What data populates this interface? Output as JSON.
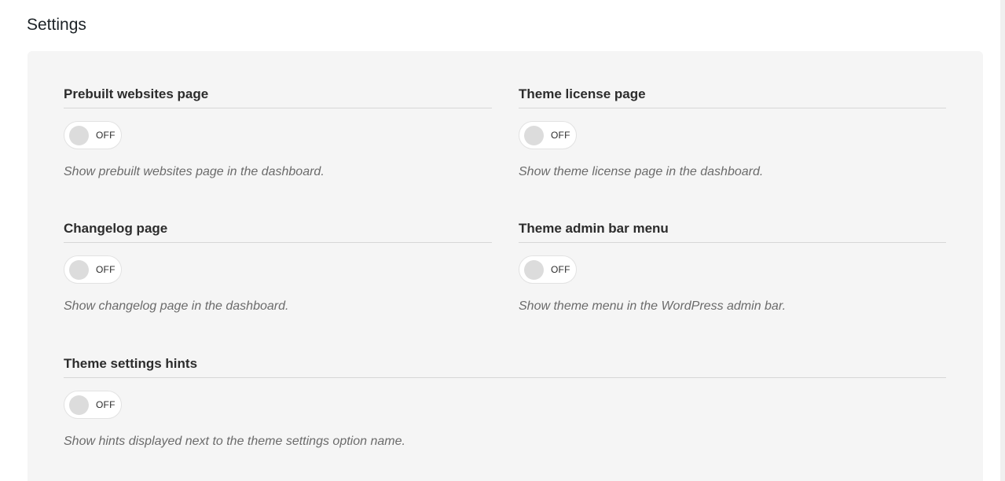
{
  "page": {
    "title": "Settings"
  },
  "settings": [
    {
      "title": "Prebuilt websites page",
      "toggle_label": "OFF",
      "description": "Show prebuilt websites page in the dashboard.",
      "enabled": false
    },
    {
      "title": "Theme license page",
      "toggle_label": "OFF",
      "description": "Show theme license page in the dashboard.",
      "enabled": false
    },
    {
      "title": "Changelog page",
      "toggle_label": "OFF",
      "description": "Show changelog page in the dashboard.",
      "enabled": false
    },
    {
      "title": "Theme admin bar menu",
      "toggle_label": "OFF",
      "description": "Show theme menu in the WordPress admin bar.",
      "enabled": false
    },
    {
      "title": "Theme settings hints",
      "toggle_label": "OFF",
      "description": "Show hints displayed next to the theme settings option name.",
      "enabled": false
    }
  ],
  "colors": {
    "panel_background": "#f5f5f5",
    "toggle_knob_off": "#dcdcdc",
    "divider": "#d7d7d7",
    "description_text": "#6b6b6b"
  }
}
